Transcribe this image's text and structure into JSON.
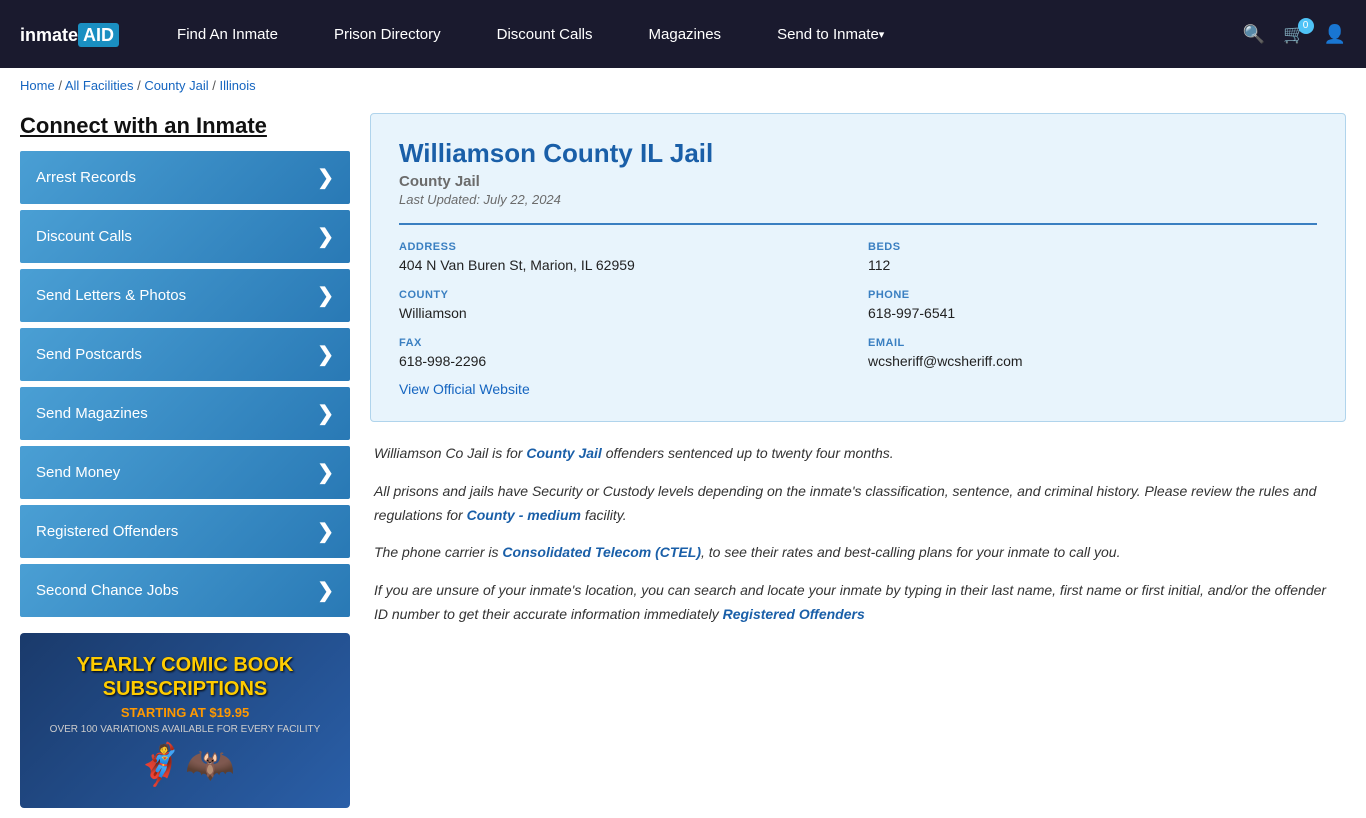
{
  "navbar": {
    "logo_text": "inmate AID",
    "nav_items": [
      {
        "label": "Find An Inmate",
        "id": "find-inmate"
      },
      {
        "label": "Prison Directory",
        "id": "prison-directory"
      },
      {
        "label": "Discount Calls",
        "id": "discount-calls"
      },
      {
        "label": "Magazines",
        "id": "magazines"
      },
      {
        "label": "Send to Inmate",
        "id": "send-to-inmate",
        "dropdown": true
      }
    ],
    "cart_count": "0"
  },
  "breadcrumb": {
    "items": [
      {
        "label": "Home",
        "href": "#"
      },
      {
        "label": "All Facilities",
        "href": "#"
      },
      {
        "label": "County Jail",
        "href": "#"
      },
      {
        "label": "Illinois",
        "href": "#"
      }
    ]
  },
  "sidebar": {
    "title": "Connect with an Inmate",
    "buttons": [
      {
        "label": "Arrest Records",
        "id": "arrest-records"
      },
      {
        "label": "Discount Calls",
        "id": "discount-calls-btn"
      },
      {
        "label": "Send Letters & Photos",
        "id": "send-letters"
      },
      {
        "label": "Send Postcards",
        "id": "send-postcards"
      },
      {
        "label": "Send Magazines",
        "id": "send-magazines"
      },
      {
        "label": "Send Money",
        "id": "send-money"
      },
      {
        "label": "Registered Offenders",
        "id": "registered-offenders"
      },
      {
        "label": "Second Chance Jobs",
        "id": "second-chance-jobs"
      }
    ],
    "ad": {
      "title": "YEARLY COMIC BOOK SUBSCRIPTIONS",
      "price": "STARTING AT $19.95",
      "note": "OVER 100 VARIATIONS AVAILABLE FOR EVERY FACILITY"
    }
  },
  "facility": {
    "name": "Williamson County IL Jail",
    "type": "County Jail",
    "last_updated": "Last Updated: July 22, 2024",
    "address_label": "ADDRESS",
    "address": "404 N Van Buren St, Marion, IL 62959",
    "beds_label": "BEDS",
    "beds": "112",
    "county_label": "COUNTY",
    "county": "Williamson",
    "phone_label": "PHONE",
    "phone": "618-997-6541",
    "fax_label": "FAX",
    "fax": "618-998-2296",
    "email_label": "EMAIL",
    "email": "wcsheriff@wcsheriff.com",
    "website_label": "View Official Website"
  },
  "description": {
    "para1_prefix": "Williamson Co Jail is for ",
    "para1_link": "County Jail",
    "para1_suffix": " offenders sentenced up to twenty four months.",
    "para2_prefix": "All prisons and jails have Security or Custody levels depending on the inmate's classification, sentence, and criminal history. Please review the rules and regulations for ",
    "para2_link": "County - medium",
    "para2_suffix": " facility.",
    "para3_prefix": "The phone carrier is ",
    "para3_link": "Consolidated Telecom (CTEL)",
    "para3_suffix": ", to see their rates and best-calling plans for your inmate to call you.",
    "para4": "If you are unsure of your inmate's location, you can search and locate your inmate by typing in their last name, first name or first initial, and/or the offender ID number to get their accurate information immediately",
    "para4_link": "Registered Offenders"
  }
}
